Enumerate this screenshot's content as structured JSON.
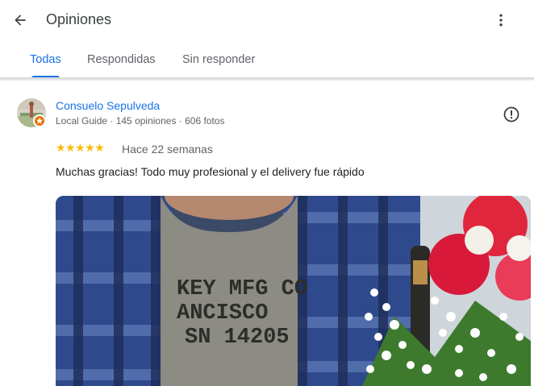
{
  "header": {
    "back_icon": "arrow-back-icon",
    "title": "Opiniones",
    "more_icon": "more-vert-icon"
  },
  "tabs": [
    {
      "label": "Todas",
      "active": true
    },
    {
      "label": "Respondidas",
      "active": false
    },
    {
      "label": "Sin responder",
      "active": false
    }
  ],
  "review": {
    "author": "Consuelo Sepulveda",
    "meta": "Local Guide · 145 opiniones · 606 fotos",
    "stars": "★★★★★",
    "rating": 5,
    "date": "Hace 22 semanas",
    "text": "Muchas gracias! Todo muy profesional y el delivery fue rápido",
    "photo_shirt_text": [
      "KEY MFG CO",
      "ANCISCO",
      "SN 14205"
    ],
    "report_icon": "report-icon"
  },
  "colors": {
    "accent": "#1a73e8",
    "star": "#fbbc04",
    "badge": "#e8710a",
    "muted": "#5f6368"
  }
}
